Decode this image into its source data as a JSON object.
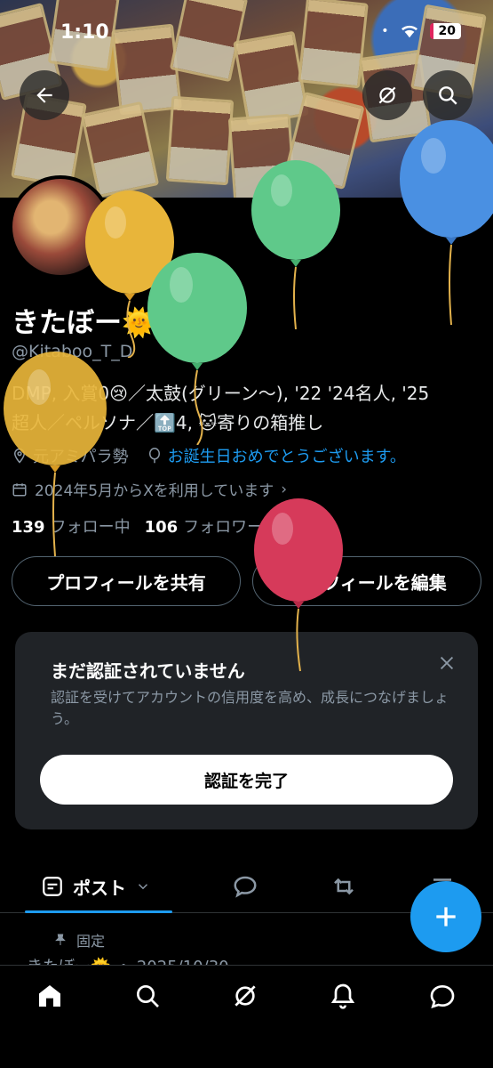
{
  "status_bar": {
    "time": "1:10",
    "battery": "20"
  },
  "profile": {
    "name": "きたぼー🌞",
    "handle": "@Kitaboo_T_D",
    "bio_line1": "DMP, 入賞0😢／太鼓(グリーン〜), '22 '24名人, '25",
    "bio_line2": "超人／ペルソナ／🔝4, 🐱寄りの箱推し",
    "location": "元アミパラ勢",
    "birthday_link": "お誕生日おめでとうございます。",
    "joined": "2024年5月からXを利用しています",
    "following_count": "139",
    "following_label": "フォロー中",
    "followers_count": "106",
    "followers_label": "フォロワー"
  },
  "actions": {
    "share": "プロフィールを共有",
    "edit": "プロフィールを編集"
  },
  "verification": {
    "title": "まだ認証されていません",
    "description": "認証を受けてアカウントの信用度を高め、成長につなげましょう。",
    "cta": "認証を完了"
  },
  "tabs": {
    "posts": "ポスト"
  },
  "pinned": {
    "label": "固定"
  },
  "peek_text": "きたぼー🌞  ・  2025/10/30",
  "colors": {
    "accent": "#1d9bf0",
    "balloon_yellow": "#e8b53a",
    "balloon_green": "#5fc98a",
    "balloon_blue": "#4a90e2",
    "balloon_red": "#d63a5a"
  }
}
